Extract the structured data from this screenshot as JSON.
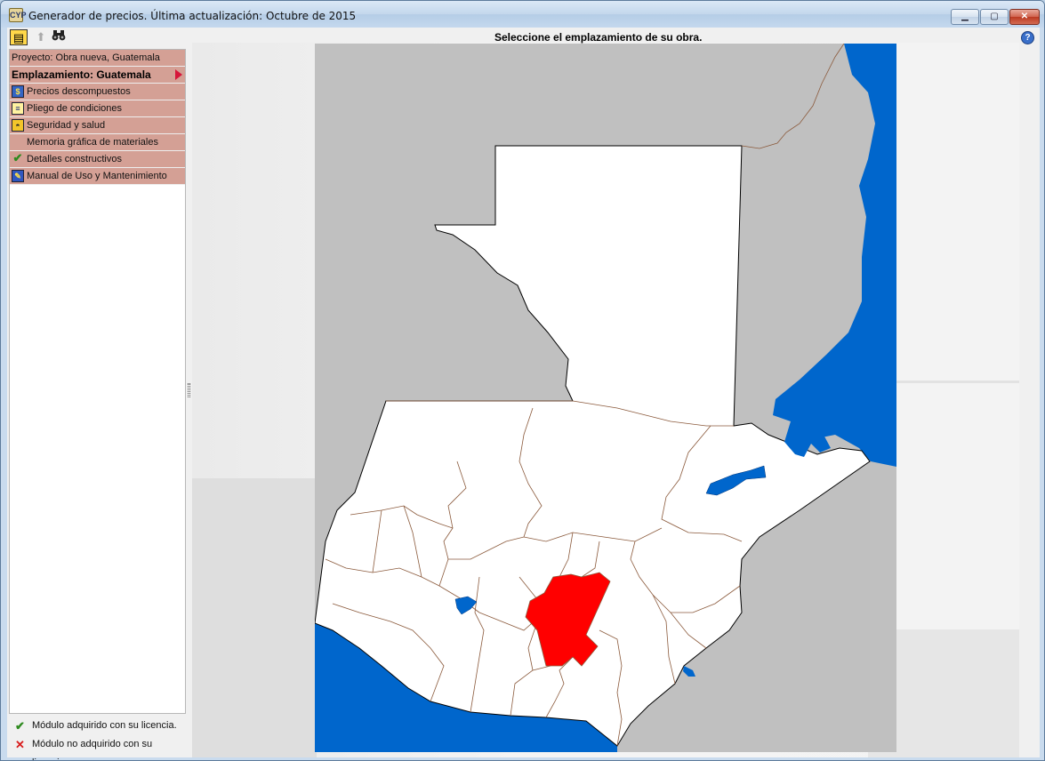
{
  "window": {
    "title": "Generador de precios. Última actualización: Octubre de 2015",
    "app_icon_label": "CYP"
  },
  "controls": {
    "minimize": "▁",
    "maximize": "▢",
    "close": "✕"
  },
  "toolbar": {
    "icons": [
      "properties-icon",
      "up-arrow-icon",
      "binoculars-icon"
    ],
    "up_glyph": "⬆",
    "binoculars_glyph": "⛭"
  },
  "sidebar": {
    "project": "Proyecto: Obra nueva, Guatemala",
    "location": "Emplazamiento: Guatemala",
    "items": [
      {
        "label": "Precios descompuestos",
        "icon": "price-tag-icon"
      },
      {
        "label": "Pliego de condiciones",
        "icon": "document-icon"
      },
      {
        "label": "Seguridad y salud",
        "icon": "helmet-icon"
      },
      {
        "label": "Memoria gráfica de materiales",
        "icon": ""
      },
      {
        "label": "Detalles constructivos",
        "icon": "check-icon"
      },
      {
        "label": "Manual de Uso y Mantenimiento",
        "icon": "wrench-icon"
      }
    ]
  },
  "legend": {
    "acquired": "Módulo adquirido con su licencia.",
    "not_acquired": "Módulo no adquirido con su licencia."
  },
  "main": {
    "heading": "Seleccione el emplazamiento de su obra.",
    "help": "?"
  },
  "map": {
    "selected_department": "Guatemala",
    "colors": {
      "land": "#ffffff",
      "neighbor": "#c0c0c0",
      "water": "#0066cc",
      "selected": "#ff0000",
      "border": "#8b5a3c",
      "outline": "#000000"
    }
  }
}
